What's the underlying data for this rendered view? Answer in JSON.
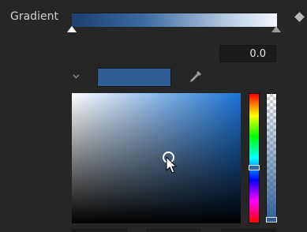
{
  "gradient": {
    "label": "Gradient",
    "start_color": "#1c3f6e",
    "end_color": "#f3f6fa"
  },
  "value_field": {
    "value": "0.0"
  },
  "color": {
    "current_swatch": "#2e5e94",
    "hue_accent": "#1a73d6"
  },
  "icons": {
    "chevron": "chevron-down-icon",
    "eyedropper": "eyedropper-icon",
    "keyframe": "diamond-icon"
  }
}
